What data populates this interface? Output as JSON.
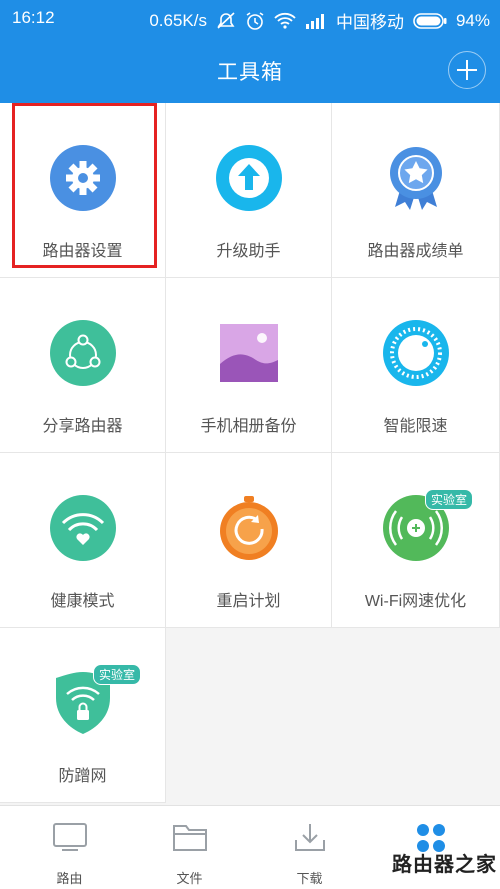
{
  "status": {
    "time": "16:12",
    "speed": "0.65K/s",
    "carrier": "中国移动",
    "battery": "94%",
    "icons": [
      "mute-icon",
      "alarm-icon",
      "wifi-icon",
      "signal-icon",
      "battery-icon"
    ]
  },
  "header": {
    "title": "工具箱",
    "add_icon": "plus-icon"
  },
  "tools": [
    {
      "label": "路由器设置",
      "icon": "gear-icon"
    },
    {
      "label": "升级助手",
      "icon": "upgrade-arrow-icon"
    },
    {
      "label": "路由器成绩单",
      "icon": "medal-star-icon"
    },
    {
      "label": "分享路由器",
      "icon": "share-icon"
    },
    {
      "label": "手机相册备份",
      "icon": "photo-album-icon"
    },
    {
      "label": "智能限速",
      "icon": "speed-dial-icon"
    },
    {
      "label": "健康模式",
      "icon": "wifi-heart-icon"
    },
    {
      "label": "重启计划",
      "icon": "restart-timer-icon"
    },
    {
      "label": "Wi-Fi网速优化",
      "icon": "wifi-boost-icon",
      "badge": "实验室"
    },
    {
      "label": "防蹭网",
      "icon": "shield-lock-icon",
      "badge": "实验室"
    }
  ],
  "tabs": [
    {
      "label": "路由",
      "icon": "monitor-icon"
    },
    {
      "label": "文件",
      "icon": "folder-icon"
    },
    {
      "label": "下载",
      "icon": "download-icon"
    },
    {
      "label": "",
      "icon": "toolbox-icon"
    }
  ],
  "watermark": "路由器之家",
  "colors": {
    "primary": "#1f8ee6",
    "highlight": "#e52222",
    "badge": "#36b9a8"
  }
}
